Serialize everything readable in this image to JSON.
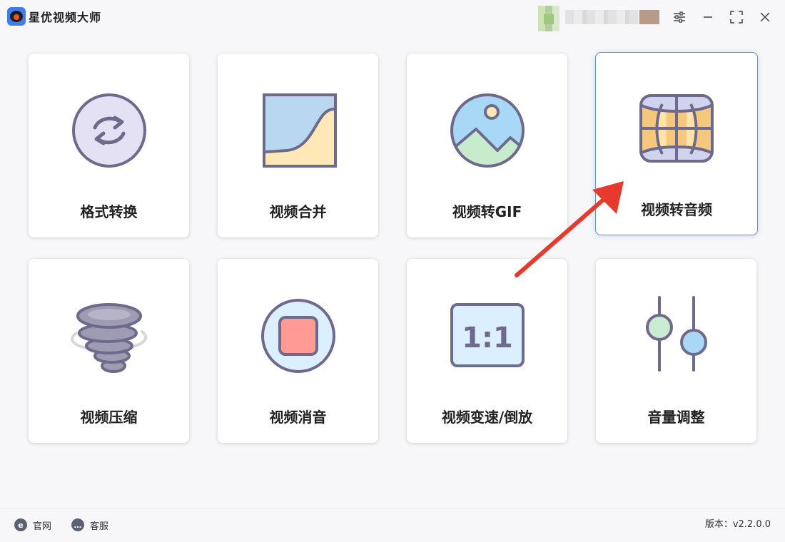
{
  "app": {
    "title": "星优视频大师",
    "logo_icon": "camera-eye-logo",
    "accent": "#3f7ee8"
  },
  "window_controls": {
    "settings_icon": "sliders-icon",
    "minimize_glyph": "—",
    "maximize_glyph": "⛶",
    "close_glyph": "✕"
  },
  "tools": [
    {
      "label": "格式转换",
      "icon": "convert-arrows-icon"
    },
    {
      "label": "视频合并",
      "icon": "merge-curve-icon"
    },
    {
      "label": "视频转GIF",
      "icon": "image-landscape-icon"
    },
    {
      "label": "视频转音频",
      "icon": "audio-globe-icon",
      "active": true
    },
    {
      "label": "视频压缩",
      "icon": "tornado-compress-icon"
    },
    {
      "label": "视频消音",
      "icon": "mute-stop-icon"
    },
    {
      "label": "视频变速/倒放",
      "icon": "ratio-1-1-icon"
    },
    {
      "label": "音量调整",
      "icon": "volume-sliders-icon"
    }
  ],
  "ratio_text": "1:1",
  "footer": {
    "site_label": "官网",
    "site_glyph": "e",
    "service_label": "客服",
    "service_glyph": "…",
    "version_text": "版本：v2.2.0.0"
  },
  "colors": {
    "card_border_active": "#5b8ee6",
    "arrow": "#e83a2c",
    "icon_stroke": "#6e6a8c"
  }
}
